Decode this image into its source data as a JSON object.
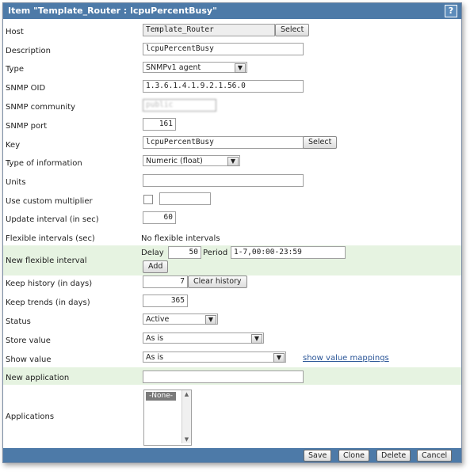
{
  "title": "Item \"Template_Router : lcpuPercentBusy\"",
  "help_label": "?",
  "fields": {
    "host": {
      "label": "Host",
      "value": "Template_Router",
      "button": "Select"
    },
    "description": {
      "label": "Description",
      "value": "lcpuPercentBusy"
    },
    "type": {
      "label": "Type",
      "value": "SNMPv1 agent"
    },
    "snmp_oid": {
      "label": "SNMP OID",
      "value": "1.3.6.1.4.1.9.2.1.56.0"
    },
    "snmp_community": {
      "label": "SNMP community",
      "value": "public"
    },
    "snmp_port": {
      "label": "SNMP port",
      "value": "161"
    },
    "key": {
      "label": "Key",
      "value": "lcpuPercentBusy",
      "button": "Select"
    },
    "type_of_information": {
      "label": "Type of information",
      "value": "Numeric (float)"
    },
    "units": {
      "label": "Units",
      "value": ""
    },
    "custom_multiplier": {
      "label": "Use custom multiplier",
      "checked": false,
      "value": ""
    },
    "update_interval": {
      "label": "Update interval (in sec)",
      "value": "60"
    },
    "flexible_intervals": {
      "label": "Flexible intervals (sec)",
      "value": "No flexible intervals"
    },
    "new_flexible_interval": {
      "label": "New flexible interval",
      "delay_label": "Delay",
      "delay_value": "50",
      "period_label": "Period",
      "period_value": "1-7,00:00-23:59",
      "add_button": "Add"
    },
    "keep_history": {
      "label": "Keep history (in days)",
      "value": "7",
      "button": "Clear history"
    },
    "keep_trends": {
      "label": "Keep trends (in days)",
      "value": "365"
    },
    "status": {
      "label": "Status",
      "value": "Active"
    },
    "store_value": {
      "label": "Store value",
      "value": "As is"
    },
    "show_value": {
      "label": "Show value",
      "value": "As is",
      "link": "show value mappings"
    },
    "new_application": {
      "label": "New application",
      "value": ""
    },
    "applications": {
      "label": "Applications",
      "options": [
        "-None-"
      ]
    }
  },
  "footer": {
    "save": "Save",
    "clone": "Clone",
    "delete": "Delete",
    "cancel": "Cancel"
  },
  "colors": {
    "titlebar": "#4d7aa8",
    "alt_row": "#e6f3e1",
    "link": "#2a5597"
  },
  "icons": {
    "dropdown": "chevron-down-icon",
    "help": "help-icon"
  }
}
